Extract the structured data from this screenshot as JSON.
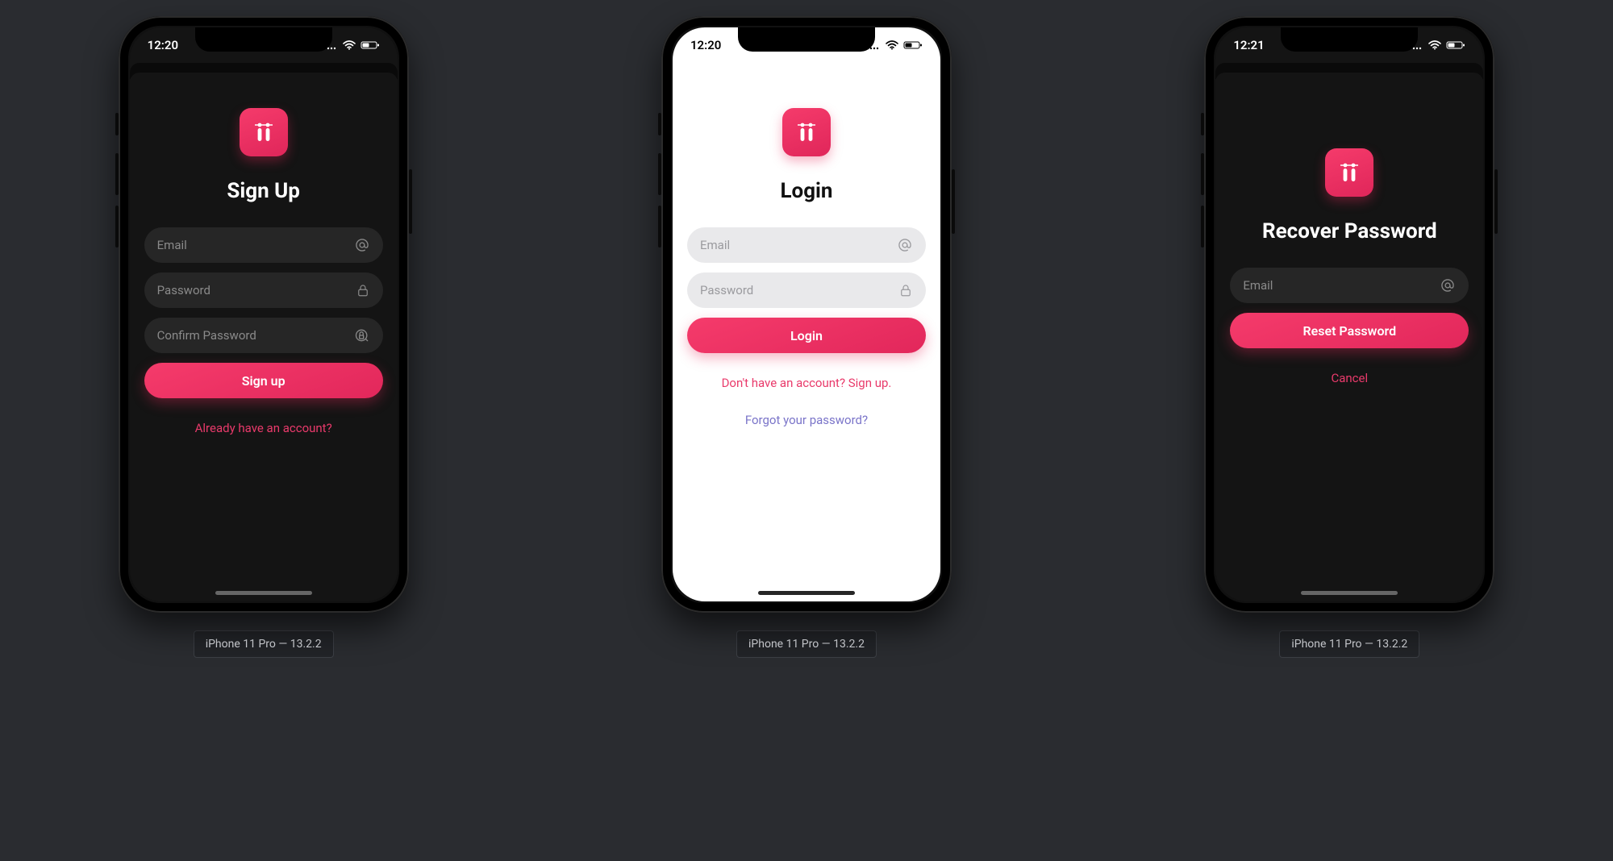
{
  "colors": {
    "accent": "#ec2e63",
    "dark_bg": "#141414",
    "light_bg": "#ffffff",
    "link_pink": "#e93a6b",
    "link_purple": "#7a74c9"
  },
  "logo_glyph": "ii",
  "screens": {
    "signup": {
      "theme": "dark",
      "status_time": "12:20",
      "title": "Sign Up",
      "fields": {
        "email_placeholder": "Email",
        "password_placeholder": "Password",
        "confirm_placeholder": "Confirm Password"
      },
      "primary_button": "Sign up",
      "secondary_link": "Already have an account?",
      "device_caption": "iPhone 11 Pro — 13.2.2"
    },
    "login": {
      "theme": "light",
      "status_time": "12:20",
      "title": "Login",
      "fields": {
        "email_placeholder": "Email",
        "password_placeholder": "Password"
      },
      "primary_button": "Login",
      "signup_link": "Don't have an account? Sign up.",
      "forgot_link": "Forgot your password?",
      "device_caption": "iPhone 11 Pro — 13.2.2"
    },
    "recover": {
      "theme": "dark",
      "status_time": "12:21",
      "title": "Recover Password",
      "fields": {
        "email_placeholder": "Email"
      },
      "primary_button": "Reset Password",
      "cancel_link": "Cancel",
      "device_caption": "iPhone 11 Pro — 13.2.2"
    }
  }
}
